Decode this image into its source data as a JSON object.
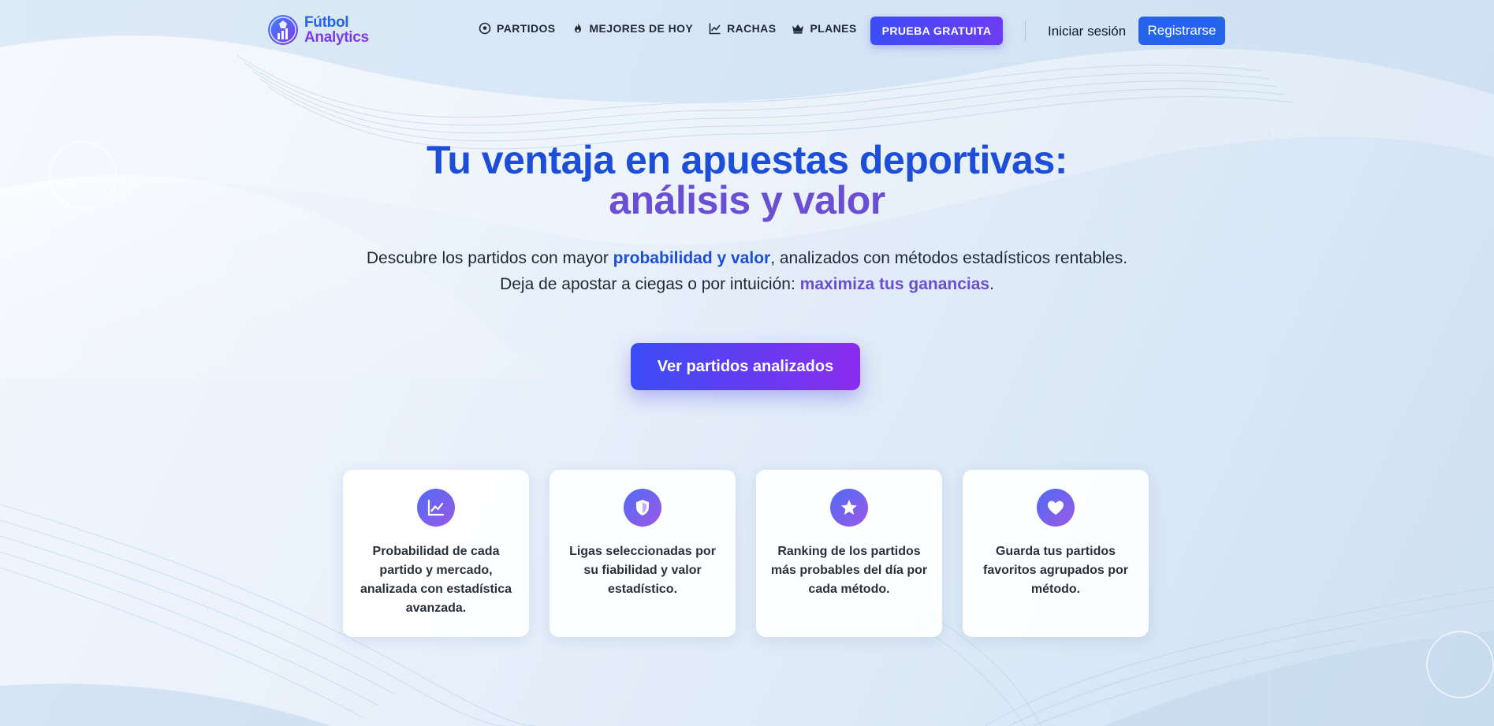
{
  "brand": {
    "line1": "Fútbol",
    "line2": "Analytics",
    "logo_icon": "soccer-ball-chart-logo"
  },
  "nav": {
    "items": [
      {
        "label": "PARTIDOS",
        "icon": "soccer-ball-icon"
      },
      {
        "label": "MEJORES DE HOY",
        "icon": "flame-icon"
      },
      {
        "label": "RACHAS",
        "icon": "trend-chart-icon"
      },
      {
        "label": "PLANES",
        "icon": "crown-icon"
      }
    ],
    "trial_label": "PRUEBA GRATUITA",
    "login_label": "Iniciar sesión",
    "register_label": "Registrarse"
  },
  "hero": {
    "title_line1": "Tu ventaja en apuestas deportivas:",
    "title_line2": "análisis y valor",
    "sub1_a": "Descubre los partidos con mayor ",
    "sub1_b": "probabilidad y valor",
    "sub1_c": ", analizados con métodos estadísticos rentables.",
    "sub2_a": "Deja de apostar a ciegas o por intuición: ",
    "sub2_b": "maximiza tus ganancias",
    "sub2_c": ".",
    "cta_label": "Ver partidos analizados"
  },
  "features": [
    {
      "icon": "line-chart-icon",
      "text": "Probabilidad de cada partido y mercado, analizada con estadística avanzada."
    },
    {
      "icon": "shield-icon",
      "text": "Ligas seleccionadas por su fiabilidad y valor estadístico."
    },
    {
      "icon": "star-icon",
      "text": "Ranking de los partidos más probables del día por cada método."
    },
    {
      "icon": "heart-icon",
      "text": "Guarda tus partidos favoritos agrupados por método."
    }
  ],
  "colors": {
    "primary": "#2563eb",
    "title_blue": "#1d4ed8",
    "accent_purple": "#6b4fd2",
    "gradient_start": "#3b4df5",
    "gradient_end": "#8b2cf0"
  }
}
